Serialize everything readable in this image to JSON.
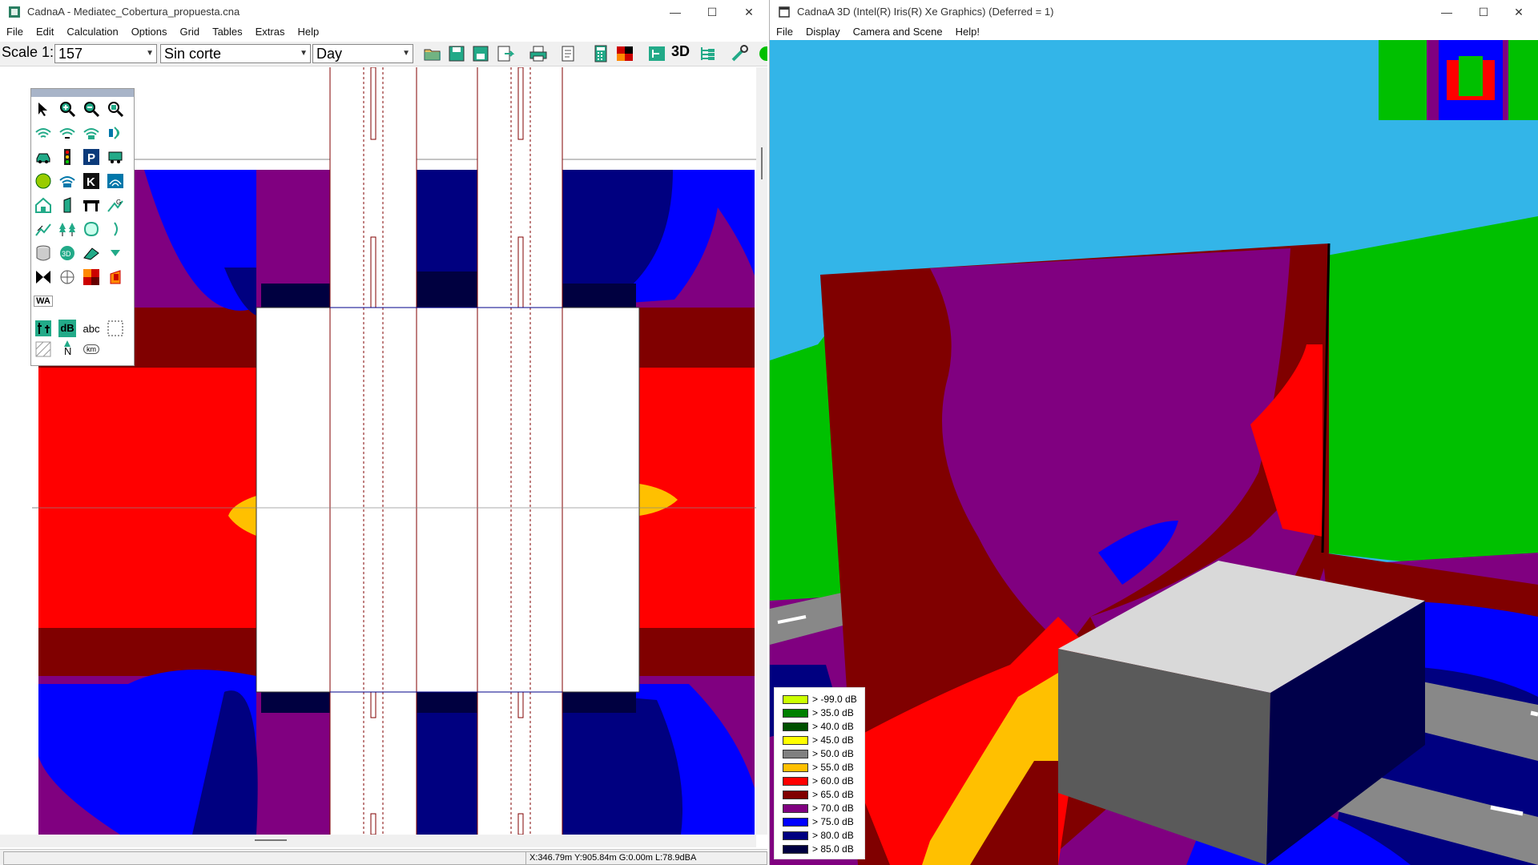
{
  "left_window": {
    "title": "CadnaA - Mediatec_Cobertura_propuesta.cna",
    "controls": {
      "minimize": "—",
      "maximize": "☐",
      "close": "✕"
    },
    "menu": [
      "File",
      "Edit",
      "Calculation",
      "Options",
      "Grid",
      "Tables",
      "Extras",
      "Help"
    ],
    "toolbar": {
      "scale_label": "Scale 1:",
      "scale_value": "157",
      "cut_value": "Sin corte",
      "period_value": "Day",
      "three_d_label": "3D"
    },
    "palette": {
      "wa_label": "WA",
      "db_label": "dB",
      "abc_label": "abc",
      "north_label": "N",
      "km_label": "km"
    },
    "status": "X:346.79m Y:905.84m G:0.00m L:78.9dBA"
  },
  "right_window": {
    "title": "CadnaA 3D (Intel(R) Iris(R) Xe Graphics) (Deferred = 1)",
    "controls": {
      "minimize": "—",
      "maximize": "☐",
      "close": "✕"
    },
    "menu": [
      "File",
      "Display",
      "Camera and Scene",
      "Help!"
    ],
    "legend": [
      {
        "label": ">  -99.0 dB",
        "color": "#ccff00"
      },
      {
        "label": ">  35.0 dB",
        "color": "#008000"
      },
      {
        "label": ">  40.0 dB",
        "color": "#005000"
      },
      {
        "label": ">  45.0 dB",
        "color": "#ffff00"
      },
      {
        "label": ">  50.0 dB",
        "color": "#808080"
      },
      {
        "label": ">  55.0 dB",
        "color": "#ffc000"
      },
      {
        "label": ">  60.0 dB",
        "color": "#ff0000"
      },
      {
        "label": ">  65.0 dB",
        "color": "#800000"
      },
      {
        "label": ">  70.0 dB",
        "color": "#800080"
      },
      {
        "label": ">  75.0 dB",
        "color": "#0000ff"
      },
      {
        "label": ">  80.0 dB",
        "color": "#000080"
      },
      {
        "label": ">  85.0 dB",
        "color": "#000040"
      }
    ]
  },
  "colors": {
    "sky": "#33b5e8",
    "grass": "#00c000",
    "red": "#ff0000",
    "darkred": "#800000",
    "purple": "#800080",
    "blue": "#0000ff",
    "navy": "#000080",
    "darknavy": "#000040",
    "orange": "#ffc000"
  }
}
